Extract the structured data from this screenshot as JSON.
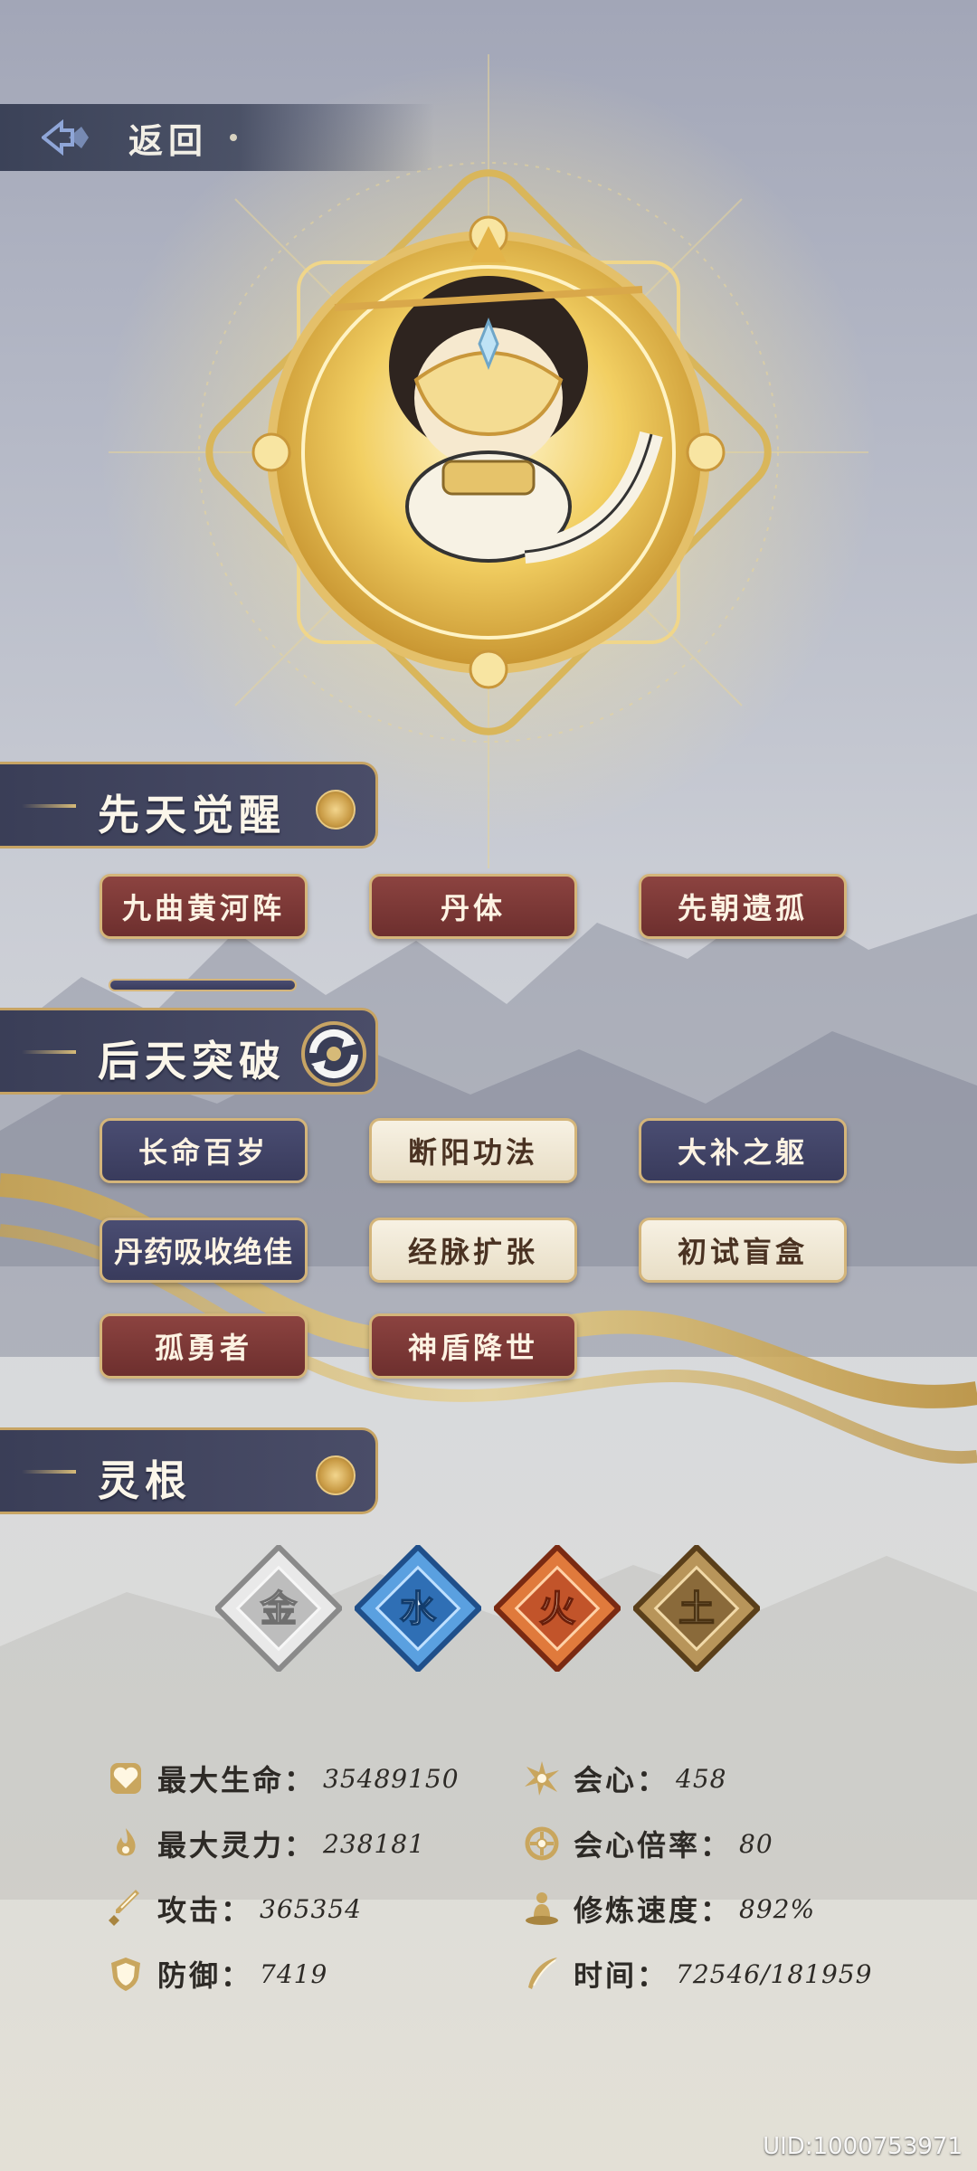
{
  "back": {
    "label": "返回"
  },
  "sections": {
    "innate": {
      "title": "先天觉醒"
    },
    "acquired": {
      "title": "后天突破"
    },
    "roots": {
      "title": "灵根"
    }
  },
  "innate_tags": [
    {
      "label": "九曲黄河阵",
      "style": "red"
    },
    {
      "label": "丹体",
      "style": "red"
    },
    {
      "label": "先朝遗孤",
      "style": "red"
    }
  ],
  "acquired_tags": [
    {
      "label": "长命百岁",
      "style": "blue"
    },
    {
      "label": "断阳功法",
      "style": "cream"
    },
    {
      "label": "大补之躯",
      "style": "blue"
    },
    {
      "label": "丹药吸收绝佳",
      "style": "blue"
    },
    {
      "label": "经脉扩张",
      "style": "cream"
    },
    {
      "label": "初试盲盒",
      "style": "cream"
    },
    {
      "label": "孤勇者",
      "style": "red"
    },
    {
      "label": "神盾降世",
      "style": "red"
    }
  ],
  "elements": [
    {
      "char": "金",
      "color": "#9a9a9a"
    },
    {
      "char": "水",
      "color": "#2f6fb5"
    },
    {
      "char": "火",
      "color": "#c2542a"
    },
    {
      "char": "土",
      "color": "#8a6a3a"
    }
  ],
  "stats_left": [
    {
      "icon": "heart-icon",
      "label": "最大生命：",
      "value": "35489150"
    },
    {
      "icon": "spirit-flame-icon",
      "label": "最大灵力：",
      "value": "238181"
    },
    {
      "icon": "sword-icon",
      "label": "攻击：",
      "value": "365354"
    },
    {
      "icon": "shield-icon",
      "label": "防御：",
      "value": "7419"
    }
  ],
  "stats_right": [
    {
      "icon": "critical-burst-icon",
      "label": "会心：",
      "value": "458"
    },
    {
      "icon": "critical-rate-icon",
      "label": "会心倍率：",
      "value": "80"
    },
    {
      "icon": "meditation-icon",
      "label": "修炼速度：",
      "value": "892%"
    },
    {
      "icon": "feather-icon",
      "label": "时间：",
      "value": "72546/181959"
    }
  ],
  "uid": "UID:1000753971",
  "colors": {
    "gold": "#d4b57a",
    "header_bg": "#3a3e57",
    "tag_red": "#7a3836",
    "tag_blue": "#3f4163",
    "tag_cream": "#f0e8d4"
  }
}
